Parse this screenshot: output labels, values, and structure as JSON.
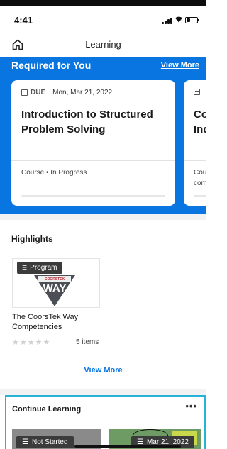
{
  "status_bar": {
    "time": "4:41"
  },
  "header": {
    "title": "Learning"
  },
  "required": {
    "title": "Required for You",
    "view_more": "View More",
    "cards": [
      {
        "due_label": "DUE",
        "due_date": "Mon, Mar 21, 2022",
        "title": "Introduction to Structured Problem Solving",
        "meta": "Course • In Progress",
        "progress": 0
      },
      {
        "title": "Co Ab Ind",
        "meta": "Cou",
        "meta2": "com"
      }
    ]
  },
  "highlights": {
    "title": "Highlights",
    "items": [
      {
        "badge": "Program",
        "logo_top": "COORSTEK",
        "logo_main": "WAY",
        "title": "The CoorsTek Way Competencies",
        "rating": "★★★★★",
        "count": "5 items"
      }
    ],
    "view_more": "View More"
  },
  "continue_learning": {
    "title": "Continue Learning",
    "more": "•••",
    "items": [
      {
        "badge": "Not Started"
      },
      {
        "badge": "Mar 21, 2022"
      }
    ]
  },
  "colors": {
    "accent": "#0875e1",
    "focus_border": "#27b3d6",
    "badge": "#3b3b3b"
  }
}
